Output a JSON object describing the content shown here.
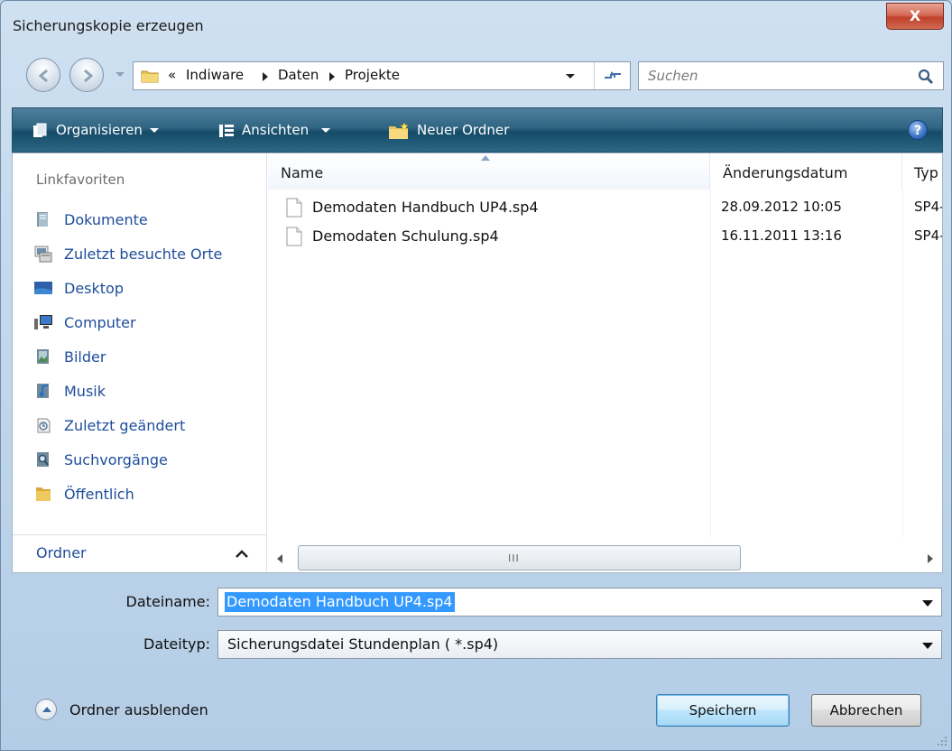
{
  "window": {
    "title": "Sicherungskopie erzeugen",
    "close_label": "X"
  },
  "navigation": {
    "breadcrumb_prefix": "«",
    "breadcrumbs": [
      "Indiware",
      "Daten",
      "Projekte"
    ],
    "search_placeholder": "Suchen"
  },
  "toolbar": {
    "organize_label": "Organisieren",
    "views_label": "Ansichten",
    "new_folder_label": "Neuer Ordner",
    "help_label": "?"
  },
  "sidebar": {
    "heading": "Linkfavoriten",
    "items": [
      {
        "label": "Dokumente",
        "icon": "documents-icon"
      },
      {
        "label": "Zuletzt besuchte Orte",
        "icon": "recent-places-icon"
      },
      {
        "label": "Desktop",
        "icon": "desktop-icon"
      },
      {
        "label": "Computer",
        "icon": "computer-icon"
      },
      {
        "label": "Bilder",
        "icon": "pictures-icon"
      },
      {
        "label": "Musik",
        "icon": "music-icon"
      },
      {
        "label": "Zuletzt geändert",
        "icon": "recently-changed-icon"
      },
      {
        "label": "Suchvorgänge",
        "icon": "searches-icon"
      },
      {
        "label": "Öffentlich",
        "icon": "public-folder-icon"
      }
    ],
    "folders_label": "Ordner"
  },
  "filelist": {
    "columns": [
      "Name",
      "Änderungsdatum",
      "Typ"
    ],
    "rows": [
      {
        "name": "Demodaten Handbuch UP4.sp4",
        "date": "28.09.2012 10:05",
        "type": "SP4-"
      },
      {
        "name": "Demodaten Schulung.sp4",
        "date": "16.11.2011 13:16",
        "type": "SP4-"
      }
    ],
    "scroll_grip": "III"
  },
  "form": {
    "filename_label": "Dateiname:",
    "filename_value": "Demodaten Handbuch UP4.sp4",
    "filetype_label": "Dateityp:",
    "filetype_value": "Sicherungsdatei Stundenplan ( *.sp4)"
  },
  "footer": {
    "hide_folders_label": "Ordner ausblenden",
    "save_label": "Speichern",
    "cancel_label": "Abbrechen"
  },
  "colors": {
    "toolbar": "#1f5a78",
    "link": "#1e4d9a",
    "selection": "#3399ff",
    "close": "#c0402b"
  }
}
